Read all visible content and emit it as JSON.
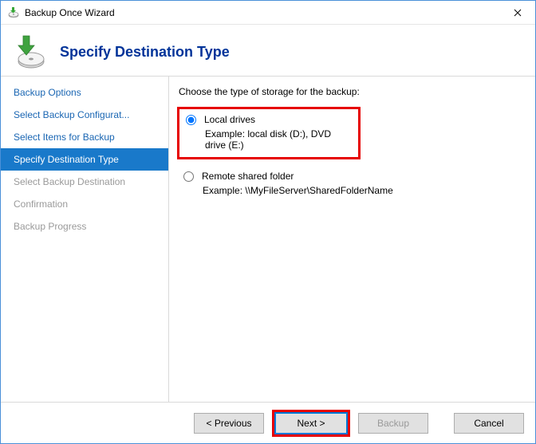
{
  "window": {
    "title": "Backup Once Wizard"
  },
  "header": {
    "title": "Specify Destination Type"
  },
  "sidebar": {
    "items": [
      {
        "label": "Backup Options"
      },
      {
        "label": "Select Backup Configurat..."
      },
      {
        "label": "Select Items for Backup"
      },
      {
        "label": "Specify Destination Type"
      },
      {
        "label": "Select Backup Destination"
      },
      {
        "label": "Confirmation"
      },
      {
        "label": "Backup Progress"
      }
    ]
  },
  "content": {
    "prompt": "Choose the type of storage for the backup:",
    "option1": {
      "label": "Local drives",
      "example": "Example: local disk (D:), DVD drive (E:)"
    },
    "option2": {
      "label": "Remote shared folder",
      "example": "Example: \\\\MyFileServer\\SharedFolderName"
    }
  },
  "footer": {
    "previous": "< Previous",
    "next": "Next >",
    "backup": "Backup",
    "cancel": "Cancel"
  }
}
